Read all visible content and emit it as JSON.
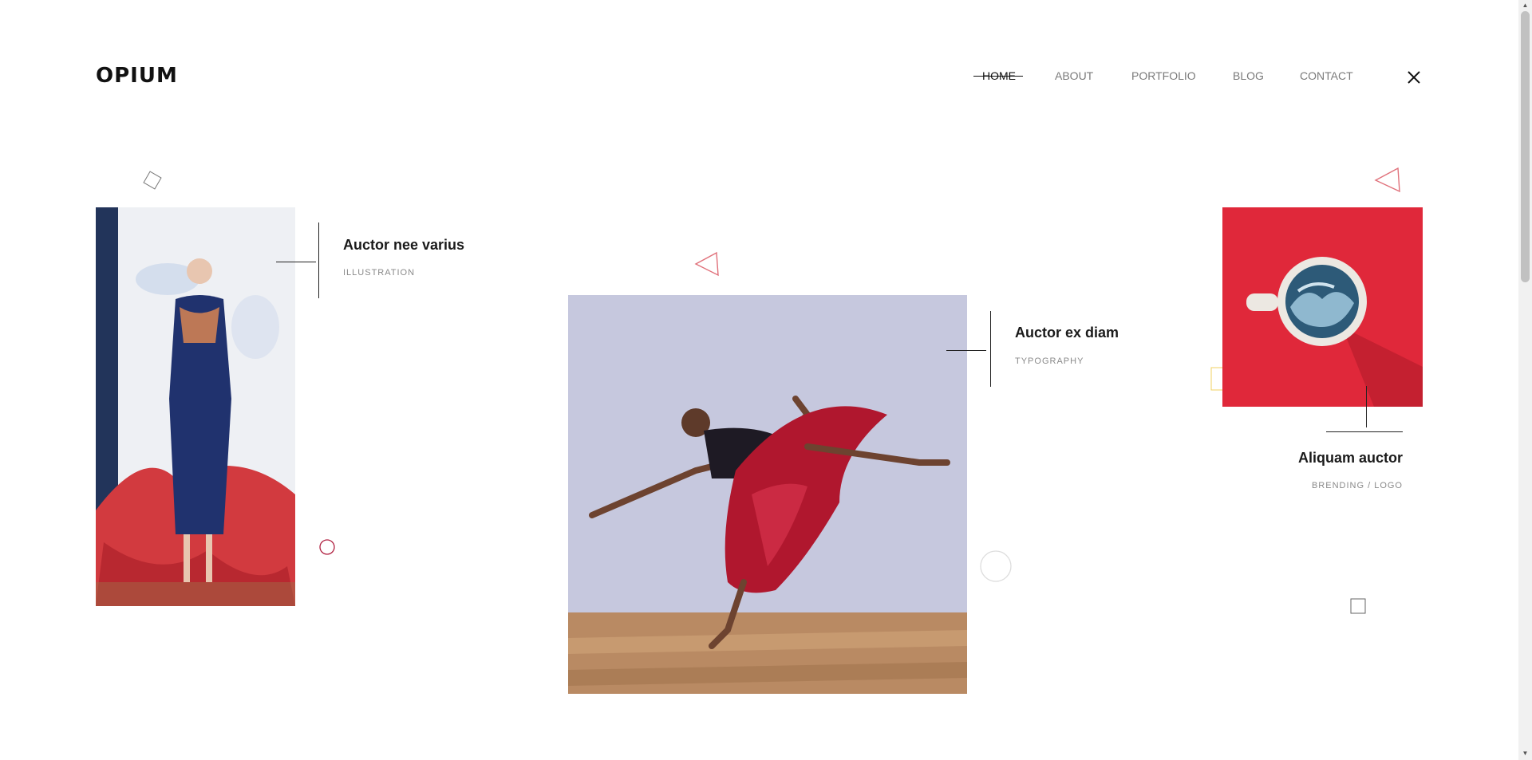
{
  "header": {
    "logo": "OPIUM",
    "nav": [
      {
        "label": "HOME",
        "active": true
      },
      {
        "label": "ABOUT",
        "active": false
      },
      {
        "label": "PORTFOLIO",
        "active": false
      },
      {
        "label": "BLOG",
        "active": false
      },
      {
        "label": "CONTACT",
        "active": false
      }
    ],
    "close_icon": "close-icon"
  },
  "portfolio": [
    {
      "title": "Auctor nee varius",
      "category": "ILLUSTRATION",
      "image": "fashion-model-photo"
    },
    {
      "title": "Auctor ex diam",
      "category": "TYPOGRAPHY",
      "image": "dancer-photo"
    },
    {
      "title": "Aliquam auctor",
      "category": "BRENDING /  LOGO",
      "image": "ocean-cup-photo"
    }
  ],
  "decorations": {
    "triangle_color": "#e0707a",
    "circle_color": "#b02040",
    "square_yellow": "#f0d060",
    "outline_gray": "#888888"
  }
}
